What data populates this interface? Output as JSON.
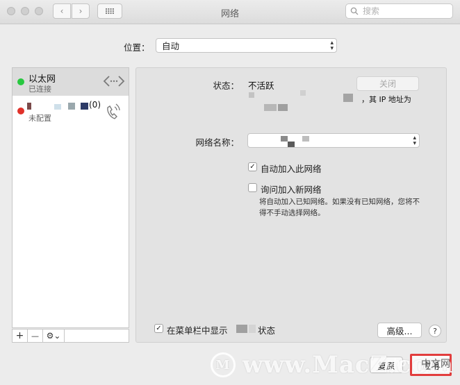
{
  "window": {
    "title": "网络",
    "search_placeholder": "搜索"
  },
  "location": {
    "label": "位置：",
    "value": "自动"
  },
  "sidebar": {
    "services": [
      {
        "name": "以太网",
        "status": "已连接",
        "status_color": "#28c840"
      },
      {
        "name": "(0)",
        "status": "未配置",
        "status_color": "#e0312a"
      }
    ],
    "add_label": "+",
    "remove_label": "—",
    "action_label": "⚙⌄"
  },
  "detail": {
    "status_label": "状态：",
    "status_value": "不活跃",
    "turn_off_button": "关闭",
    "ip_text": "，其 IP 地址为",
    "network_name_label": "网络名称：",
    "auto_join": {
      "label": "自动加入此网络",
      "checked": true
    },
    "ask_join": {
      "label": "询问加入新网络",
      "checked": false
    },
    "ask_join_note": "将自动加入已知网络。如果没有已知网络，您将不得不手动选择网络。",
    "menubar_show": {
      "prefix": "在菜单栏中显示",
      "suffix": "状态",
      "checked": true
    },
    "advanced_button": "高级...",
    "help_label": "?"
  },
  "footer": {
    "revert_button": "复原",
    "apply_button": "应用"
  },
  "watermark": {
    "text": "www.MacZ.com",
    "overlay_text": "中文网",
    "tag": "php"
  }
}
